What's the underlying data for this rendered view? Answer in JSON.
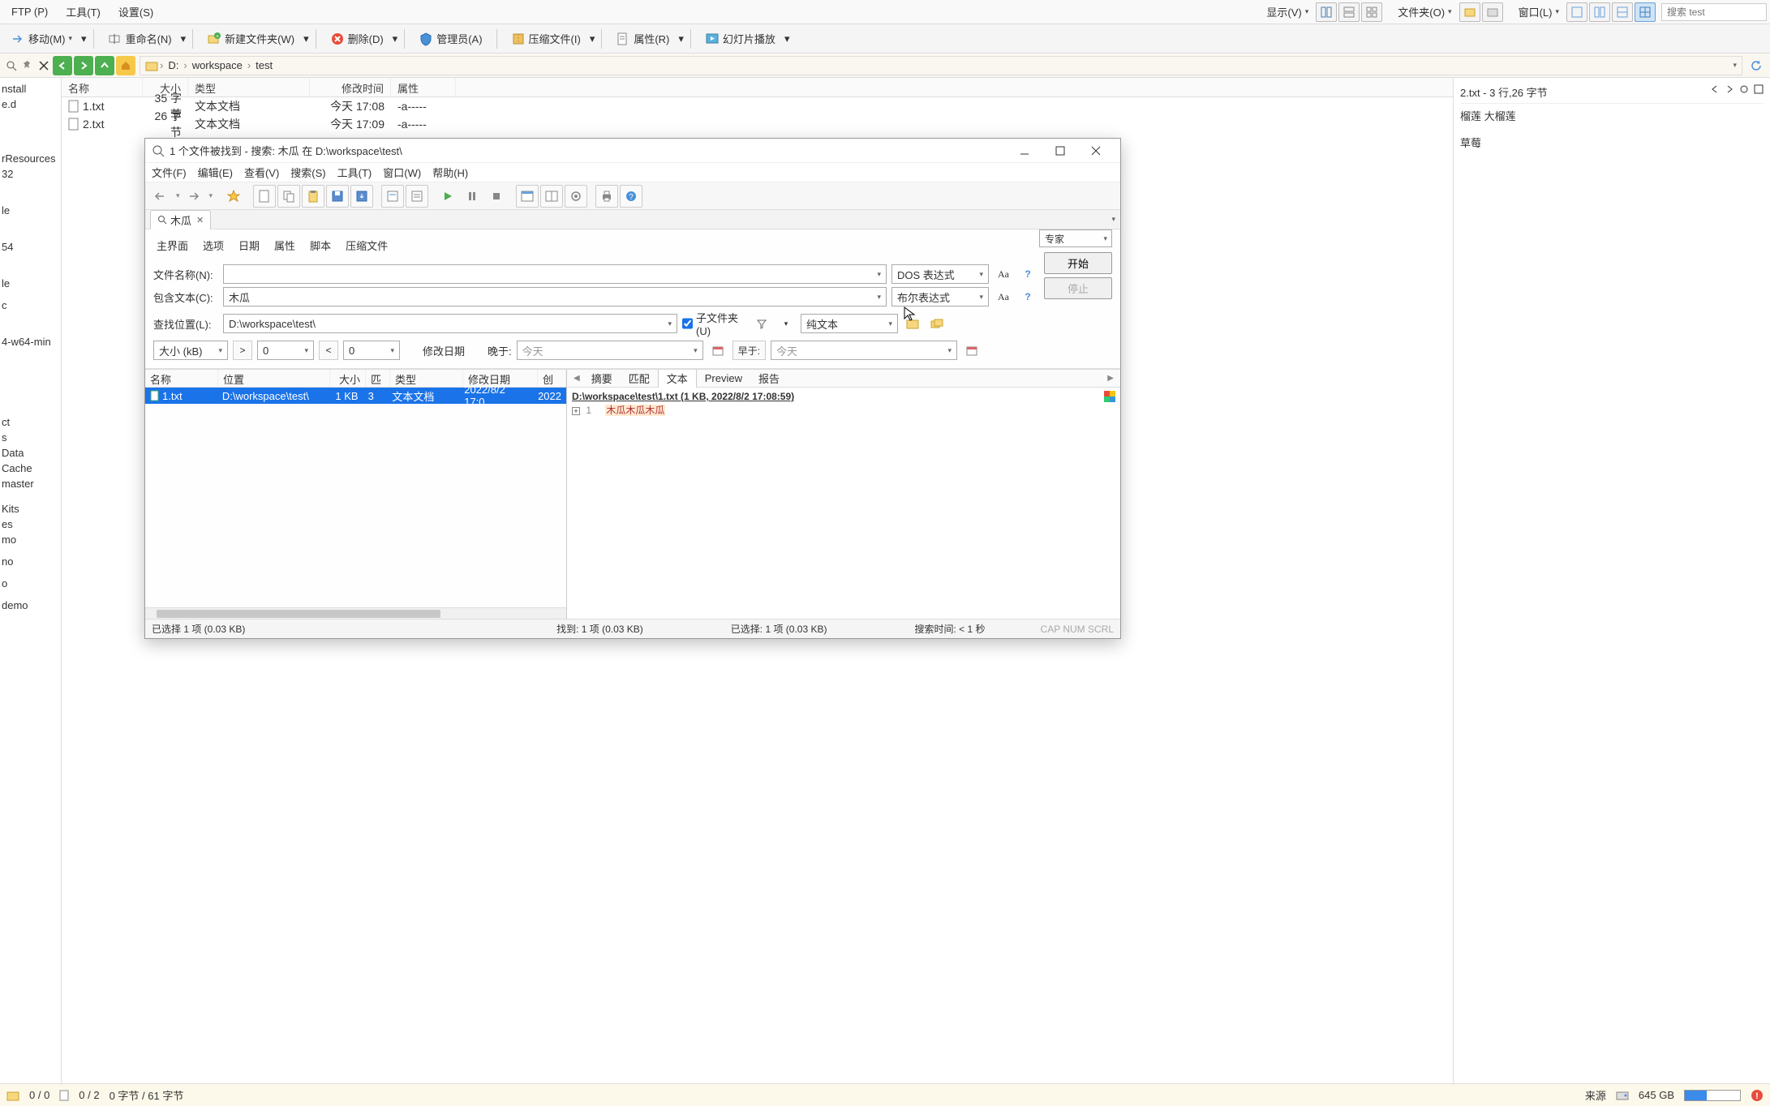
{
  "top_menu": {
    "ftp": "FTP (P)",
    "tools": "工具(T)",
    "settings": "设置(S)",
    "display": "显示(V)",
    "folder": "文件夹(O)",
    "window": "窗口(L)",
    "search_placeholder": "搜索 test"
  },
  "toolbar": {
    "move": "移动(M)",
    "rename": "重命名(N)",
    "newfolder": "新建文件夹(W)",
    "delete": "删除(D)",
    "admin": "管理员(A)",
    "compress": "压缩文件(I)",
    "attributes": "属性(R)",
    "slideshow": "幻灯片播放"
  },
  "breadcrumb": {
    "drive": "D:",
    "seg1": "workspace",
    "seg2": "test"
  },
  "file_list": {
    "headers": {
      "name": "名称",
      "size": "大小",
      "type": "类型",
      "modified": "修改时间",
      "attr": "属性"
    },
    "rows": [
      {
        "name": "1.txt",
        "size": "35 字节",
        "type": "文本文档",
        "modified": "今天 17:08",
        "attr": "-a-----"
      },
      {
        "name": "2.txt",
        "size": "26 字节",
        "type": "文本文档",
        "modified": "今天 17:09",
        "attr": "-a-----"
      }
    ]
  },
  "left_tree": {
    "items": [
      "nstall",
      "e.d",
      "rResources",
      "32",
      "le",
      "54",
      "le",
      "c",
      "4-w64-min",
      "ct",
      "s",
      "Data",
      "Cache",
      "master",
      "Kits",
      "es",
      "mo",
      "no",
      "o",
      "demo"
    ]
  },
  "right_preview": {
    "title": "2.txt - 3 行,26 字节",
    "line1": "榴莲 大榴莲",
    "line2": "草莓"
  },
  "search_dialog": {
    "title": "1 个文件被找到 - 搜索: 木瓜 在 D:\\workspace\\test\\",
    "menu": {
      "file": "文件(F)",
      "edit": "编辑(E)",
      "view": "查看(V)",
      "search": "搜索(S)",
      "tools": "工具(T)",
      "window": "窗口(W)",
      "help": "帮助(H)"
    },
    "tab_label": "木瓜",
    "form_tabs": {
      "main": "主界面",
      "options": "选项",
      "date": "日期",
      "attr": "属性",
      "script": "脚本",
      "zip": "压缩文件"
    },
    "expert": "专家",
    "labels": {
      "filename": "文件名称(N):",
      "contains": "包含文本(C):",
      "location": "查找位置(L):",
      "subfolders": "子文件夹(U)",
      "size_kb": "大小 (kB)",
      "mod_date": "修改日期",
      "after": "晚于:",
      "before": "早于:"
    },
    "values": {
      "filename": "",
      "contains": "木瓜",
      "location": "D:\\workspace\\test\\",
      "filter1": "DOS 表达式",
      "filter2": "布尔表达式",
      "encoding": "纯文本",
      "gt": ">",
      "gt_val": "0",
      "lt": "<",
      "lt_val": "0",
      "after_val": "今天",
      "before_val": "今天"
    },
    "buttons": {
      "start": "开始",
      "stop": "停止"
    },
    "results": {
      "headers": {
        "name": "名称",
        "location": "位置",
        "size": "大小",
        "match": "匹配",
        "type": "类型",
        "modified": "修改日期",
        "created": "创"
      },
      "row": {
        "name": "1.txt",
        "location": "D:\\workspace\\test\\",
        "size": "1 KB",
        "match": "3",
        "type": "文本文档",
        "modified": "2022/8/2 17:0...",
        "created": "2022"
      },
      "right_tabs": {
        "summary": "摘要",
        "match": "匹配",
        "text": "文本",
        "preview": "Preview",
        "report": "报告"
      },
      "right_path": "D:\\workspace\\test\\1.txt   (1 KB,  2022/8/2 17:08:59)",
      "right_line_no": "1",
      "right_match": "木瓜木瓜木瓜"
    },
    "status": {
      "selected": "已选择 1 项 (0.03 KB)",
      "found": "找到: 1 项 (0.03 KB)",
      "selected2": "已选择: 1 项 (0.03 KB)",
      "time": "搜索时间: < 1 秒",
      "caps": "CAP NUM SCRL"
    }
  },
  "status_bar": {
    "folders": "0 / 0",
    "files": "0 / 2",
    "bytes": "0 字节 / 61 字节",
    "source": "来源",
    "disk": "645 GB"
  }
}
